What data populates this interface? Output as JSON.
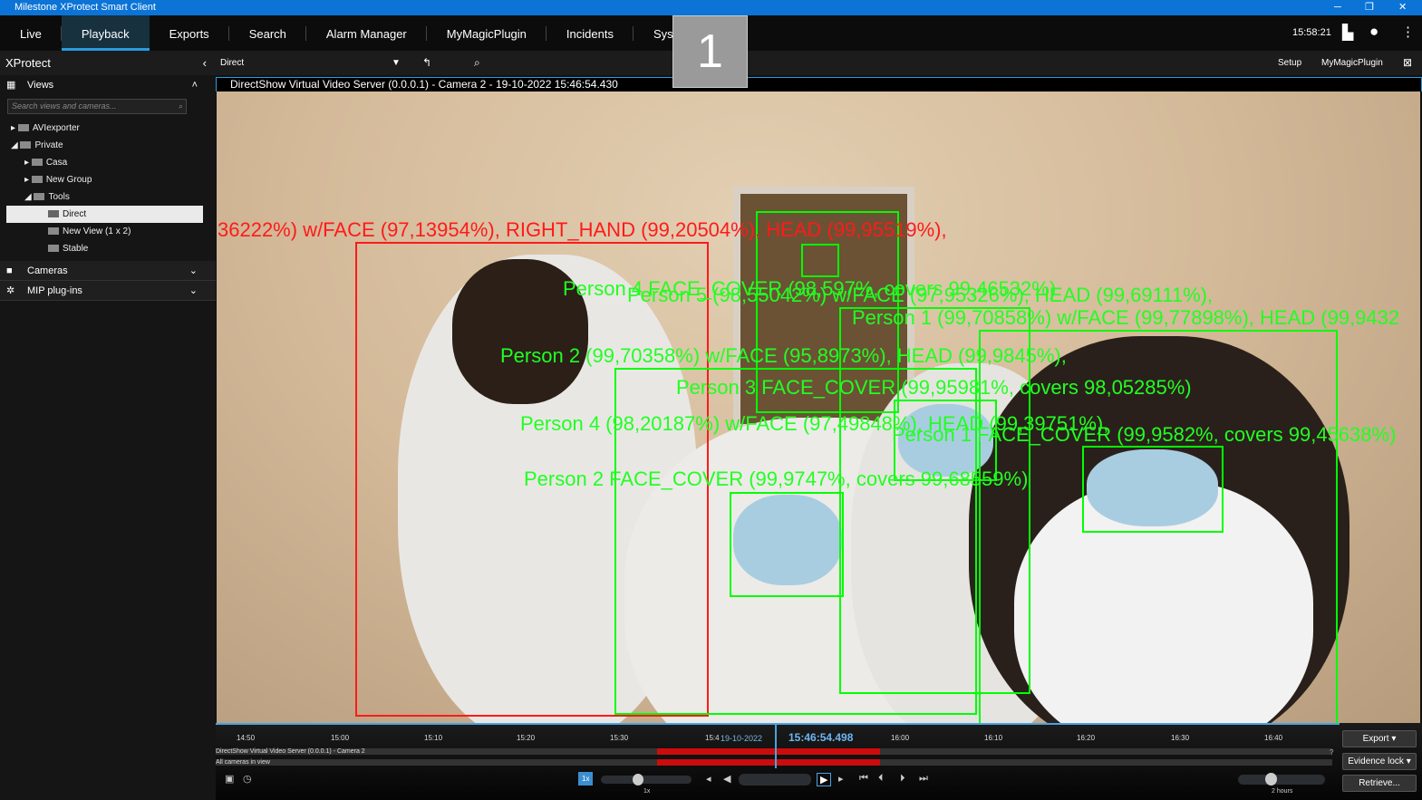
{
  "window": {
    "title": "Milestone XProtect Smart Client",
    "minimize": "─",
    "restore": "❐",
    "close": "✕"
  },
  "nav": {
    "tabs": [
      {
        "label": "Live"
      },
      {
        "label": "Playback",
        "active": true
      },
      {
        "label": "Exports"
      },
      {
        "label": "Search"
      },
      {
        "label": "Alarm Manager"
      },
      {
        "label": "MyMagicPlugin"
      },
      {
        "label": "Incidents"
      },
      {
        "label": "Syst"
      }
    ],
    "clock": "15:58:21",
    "overlay_number": "1"
  },
  "toolbar": {
    "view": "Direct",
    "setup": "Setup",
    "plugin": "MyMagicPlugin"
  },
  "sidebar": {
    "title": "XProtect",
    "views_label": "Views",
    "search_placeholder": "Search views and cameras...",
    "tree": [
      "AVIexporter",
      "Private",
      "Casa",
      "New Group",
      "Tools",
      "Direct",
      "New View (1 x 2)",
      "Stable"
    ],
    "cameras_label": "Cameras",
    "mip_label": "MIP plug-ins"
  },
  "video": {
    "header": "DirectShow Virtual Video Server (0.0.0.1) - Camera 2 - 19-10-2022 15:46:54.430",
    "overlays": [
      "36222%) w/FACE (97,13954%), RIGHT_HAND (99,20504%), HEAD (99,95519%),",
      "Person 4 FACE_COVER (98,597%, covers 99,46532%)",
      "Person 5 (98,55042%) w/FACE (97,95326%), HEAD (99,69111%),",
      "Person 1 (99,70858%) w/FACE (99,77898%), HEAD (99,9432",
      "Person 2 (99,70358%) w/FACE (95,8973%), HEAD (99,9845%),",
      "Person 3 FACE_COVER (99,95981%, covers 98,05285%)",
      "Person 4 (98,20187%) w/FACE (97,49848%), HEAD (99,39751%),",
      "Person 1 FACE_COVER (99,9582%, covers 99,45638%)",
      "Person 2 FACE_COVER (99,9747%, covers 99,68559%)"
    ],
    "colors": {
      "detection": "#00ff00",
      "alert": "#ff1a1a"
    }
  },
  "timeline": {
    "ticks": [
      "14:50",
      "15:00",
      "15:10",
      "15:20",
      "15:30",
      "15:4",
      "16:00",
      "16:10",
      "16:20",
      "16:30",
      "16:40"
    ],
    "date": "19-10-2022",
    "current_time": "15:46:54.498",
    "tracks": [
      "DirectShow Virtual Video Server (0.0.0.1) - Camera 2",
      "All cameras in view"
    ],
    "speed": "1x",
    "speed_label": "1x",
    "span_label": "2 hours",
    "buttons": {
      "export": "Export",
      "evidence": "Evidence lock",
      "retrieve": "Retrieve..."
    },
    "help": "?"
  }
}
